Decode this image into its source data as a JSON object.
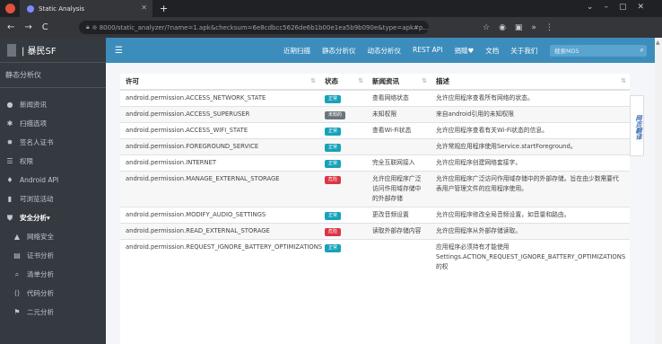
{
  "browser": {
    "tab_title": "Static Analysis",
    "url_text": "8000/static_analyzer/?name=1.apk&checksum=6e8cdbcc5626de6b1b00e1ea5b9b090e&type=apk#p..."
  },
  "sidebar": {
    "brand": "| 暴民SF",
    "section": "静态分析仪",
    "items": [
      {
        "label": "新闻资讯",
        "icon": "info-icon"
      },
      {
        "label": "扫描选项",
        "icon": "cog-icon"
      },
      {
        "label": "签名人证书",
        "icon": "certificate-icon"
      },
      {
        "label": "权限",
        "icon": "list-icon"
      },
      {
        "label": "Android API",
        "icon": "android-icon"
      },
      {
        "label": "可浏览活动",
        "icon": "clipboard-icon"
      },
      {
        "label": "安全分析▾",
        "icon": "shield-icon",
        "open": true
      },
      {
        "label": "网络安全",
        "icon": "lock-icon",
        "sub": true
      },
      {
        "label": "证书分析",
        "icon": "id-card-icon",
        "sub": true
      },
      {
        "label": "清单分析",
        "icon": "search-icon",
        "sub": true
      },
      {
        "label": "代码分析",
        "icon": "code-icon",
        "sub": true
      },
      {
        "label": "二元分析",
        "icon": "flag-icon",
        "sub": true
      }
    ]
  },
  "topnav": {
    "links": [
      "近期扫描",
      "静态分析仪",
      "动态分析仪",
      "REST API",
      "捐赠♥",
      "文档",
      "关于我们"
    ],
    "search_placeholder": "搜索MD5"
  },
  "table": {
    "headers": [
      "许可",
      "状态",
      "新闻资讯",
      "描述"
    ],
    "rows": [
      {
        "permission": "android.permission.ACCESS_NETWORK_STATE",
        "status": "正常",
        "status_type": "normal",
        "info": "查看网络状态",
        "desc": "允许应用程序查看所有网络的状态。"
      },
      {
        "permission": "android.permission.ACCESS_SUPERUSER",
        "status": "未知的",
        "status_type": "unknown",
        "info": "未知权限",
        "desc": "来自android引用的未知权限"
      },
      {
        "permission": "android.permission.ACCESS_WIFI_STATE",
        "status": "正常",
        "status_type": "normal",
        "info": "查看Wi-Fi状态",
        "desc": "允许应用程序查看有关Wi-Fi状态的信息。"
      },
      {
        "permission": "android.permission.FOREGROUND_SERVICE",
        "status": "正常",
        "status_type": "normal",
        "info": "",
        "desc": "允许常规应用程序使用Service.startForeground。"
      },
      {
        "permission": "android.permission.INTERNET",
        "status": "正常",
        "status_type": "normal",
        "info": "完全互联网接入",
        "desc": "允许应用程序创建网络套接字。"
      },
      {
        "permission": "android.permission.MANAGE_EXTERNAL_STORAGE",
        "status": "危险",
        "status_type": "danger",
        "info": "允许应用程序广泛访问作用域存储中的外部存储",
        "desc": "允许应用程序广泛访问作用域存储中的外部存储。旨在由少数需要代表用户管理文件的应用程序使用。"
      },
      {
        "permission": "android.permission.MODIFY_AUDIO_SETTINGS",
        "status": "正常",
        "status_type": "normal",
        "info": "更改音频设置",
        "desc": "允许应用程序修改全局音频设置，如音量和路由。"
      },
      {
        "permission": "android.permission.READ_EXTERNAL_STORAGE",
        "status": "危险",
        "status_type": "danger",
        "info": "读取外部存储内容",
        "desc": "允许应用程序从外部存储读取。"
      },
      {
        "permission": "android.permission.REQUEST_IGNORE_BATTERY_OPTIMIZATIONS",
        "status": "正常",
        "status_type": "normal",
        "info": "",
        "desc": "应用程序必须持有才能使用 Settings.ACTION_REQUEST_IGNORE_BATTERY_OPTIMIZATIONS的权"
      }
    ]
  },
  "translate_label": "网页翻译"
}
